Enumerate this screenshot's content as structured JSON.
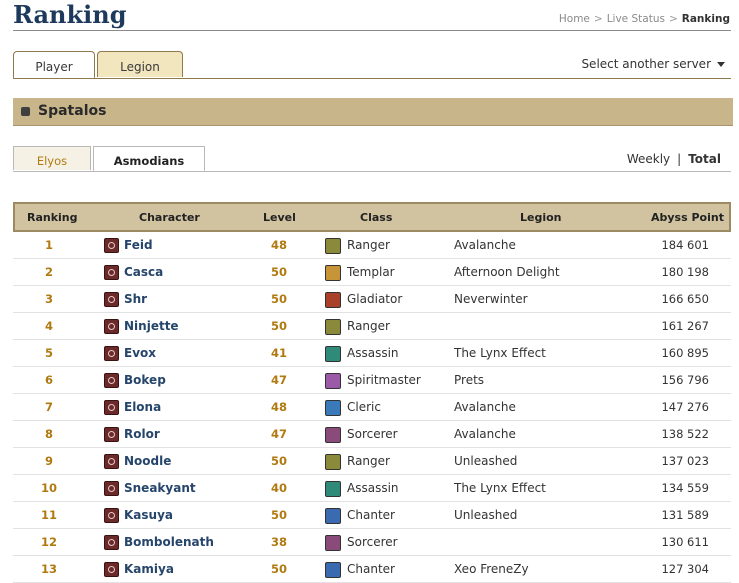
{
  "header": {
    "title": "Ranking",
    "breadcrumb": [
      "Home",
      "Live Status",
      "Ranking"
    ]
  },
  "main_tabs": [
    {
      "label": "Player",
      "active": true
    },
    {
      "label": "Legion",
      "active": false
    }
  ],
  "server_select": {
    "label": "Select another server"
  },
  "server": {
    "name": "Spatalos"
  },
  "faction_tabs": [
    {
      "label": "Elyos",
      "active": false
    },
    {
      "label": "Asmodians",
      "active": true
    }
  ],
  "period": {
    "weekly": "Weekly",
    "separator": "|",
    "total": "Total",
    "selected": "Total"
  },
  "table": {
    "columns": [
      "Ranking",
      "Character",
      "Level",
      "Class",
      "Legion",
      "Abyss Point"
    ],
    "rows": [
      {
        "rank": "1",
        "character": "Feid",
        "level": "48",
        "class": "Ranger",
        "class_icon": "ranger-icon",
        "legion": "Avalanche",
        "abyss": "184 601"
      },
      {
        "rank": "2",
        "character": "Casca",
        "level": "50",
        "class": "Templar",
        "class_icon": "templar-icon",
        "legion": "Afternoon Delight",
        "abyss": "180 198"
      },
      {
        "rank": "3",
        "character": "Shr",
        "level": "50",
        "class": "Gladiator",
        "class_icon": "gladiator-icon",
        "legion": "Neverwinter",
        "abyss": "166 650"
      },
      {
        "rank": "4",
        "character": "Ninjette",
        "level": "50",
        "class": "Ranger",
        "class_icon": "ranger-icon",
        "legion": "",
        "abyss": "161 267"
      },
      {
        "rank": "5",
        "character": "Evox",
        "level": "41",
        "class": "Assassin",
        "class_icon": "assassin-icon",
        "legion": "The Lynx Effect",
        "abyss": "160 895"
      },
      {
        "rank": "6",
        "character": "Bokep",
        "level": "47",
        "class": "Spiritmaster",
        "class_icon": "spiritmaster-icon",
        "legion": "Prets",
        "abyss": "156 796"
      },
      {
        "rank": "7",
        "character": "Elona",
        "level": "48",
        "class": "Cleric",
        "class_icon": "cleric-icon",
        "legion": "Avalanche",
        "abyss": "147 276"
      },
      {
        "rank": "8",
        "character": "Rolor",
        "level": "47",
        "class": "Sorcerer",
        "class_icon": "sorcerer-icon",
        "legion": "Avalanche",
        "abyss": "138 522"
      },
      {
        "rank": "9",
        "character": "Noodle",
        "level": "50",
        "class": "Ranger",
        "class_icon": "ranger-icon",
        "legion": "Unleashed",
        "abyss": "137 023"
      },
      {
        "rank": "10",
        "character": "Sneakyant",
        "level": "40",
        "class": "Assassin",
        "class_icon": "assassin-icon",
        "legion": "The Lynx Effect",
        "abyss": "134 559"
      },
      {
        "rank": "11",
        "character": "Kasuya",
        "level": "50",
        "class": "Chanter",
        "class_icon": "chanter-icon",
        "legion": "Unleashed",
        "abyss": "131 589"
      },
      {
        "rank": "12",
        "character": "Bombolenath",
        "level": "38",
        "class": "Sorcerer",
        "class_icon": "sorcerer-icon",
        "legion": "",
        "abyss": "130 611"
      },
      {
        "rank": "13",
        "character": "Kamiya",
        "level": "50",
        "class": "Chanter",
        "class_icon": "chanter-icon",
        "legion": "Xeo FreneZy",
        "abyss": "127 304"
      }
    ]
  },
  "colors": {
    "title": "#1d3a5c",
    "accent_gold": "#b07a10",
    "character_name": "#26456b",
    "server_bar": "#c8b58a",
    "tab_inactive": "#f2e6bf",
    "header_row": "#d2c3a0"
  },
  "class_colors": {
    "Ranger": "#8a8a3a",
    "Templar": "#c89438",
    "Gladiator": "#a8402a",
    "Assassin": "#2f8a7a",
    "Spiritmaster": "#9a5aa8",
    "Cleric": "#3a7ab8",
    "Sorcerer": "#8a4a7a",
    "Chanter": "#3a6ab0"
  }
}
